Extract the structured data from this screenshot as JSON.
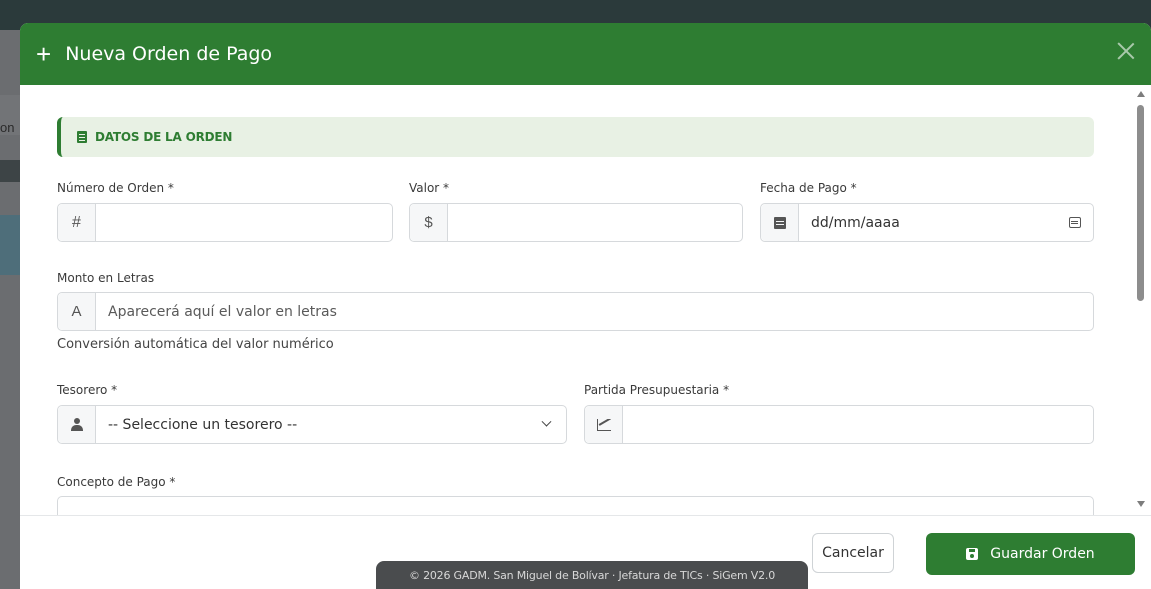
{
  "modal": {
    "title": "Nueva Orden de Pago",
    "header_icon": "plus-icon",
    "close_icon": "close-icon",
    "accent_color": "#2e7d32"
  },
  "background": {
    "fragment": "on"
  },
  "section": {
    "title": "DATOS DE LA ORDEN",
    "icon": "file-icon"
  },
  "fields": {
    "numero_orden": {
      "label": "Número de Orden *",
      "icon": "hash-icon",
      "icon_glyph": "#",
      "value": ""
    },
    "valor": {
      "label": "Valor *",
      "icon": "dollar-icon",
      "icon_glyph": "$",
      "value": ""
    },
    "fecha_pago": {
      "label": "Fecha de Pago *",
      "icon": "calendar-icon",
      "placeholder": "dd/mm/aaaa"
    },
    "monto_letras": {
      "label": "Monto en Letras",
      "icon": "font-icon",
      "icon_glyph": "A",
      "placeholder": "Aparecerá aquí el valor en letras",
      "help": "Conversión automática del valor numérico"
    },
    "tesorero": {
      "label": "Tesorero *",
      "icon": "user-tie-icon",
      "selected": "-- Seleccione un tesorero --"
    },
    "partida": {
      "label": "Partida Presupuestaria *",
      "icon": "chart-line-icon",
      "value": ""
    },
    "concepto": {
      "label": "Concepto de Pago *"
    }
  },
  "footer": {
    "cancel_label": "Cancelar",
    "save_label": "Guardar Orden",
    "save_icon": "save-icon"
  },
  "toast": {
    "text": "© 2026 GADM. San Miguel de Bolívar · Jefatura de TICs  ·  SiGem V2.0"
  }
}
